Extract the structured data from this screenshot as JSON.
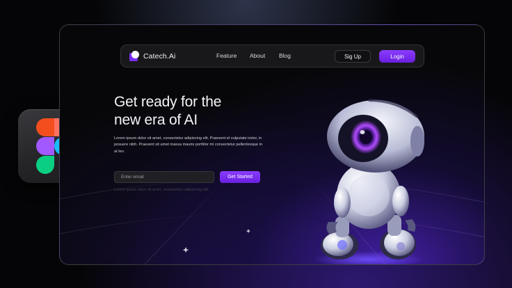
{
  "brand": {
    "name": "Catech.Ai"
  },
  "nav": {
    "links": [
      "Feature",
      "About",
      "Blog"
    ],
    "signup_label": "Sig Up",
    "login_label": "Login"
  },
  "hero": {
    "title_line1": "Get ready for the",
    "title_line2": "new era of AI",
    "description": "Lorem ipsum dolor sit amet, consectetur adipiscing elit. Praesent et vulputate tortor, in posuere nibh. Praesent sit amet massa mauris porttitor mi consectetur pellentesque in at leo.",
    "email_placeholder": "Enter email",
    "cta_label": "Get Started",
    "note": "Lorem ipsum dolor sit amet, consectetur adipiscing elit."
  },
  "colors": {
    "accent": "#7a2ff0",
    "background": "#050507",
    "nav_background": "#18181b"
  },
  "icons": {
    "app_tile": "figma-logo-icon",
    "brand_mark": "catech-logo-icon"
  }
}
